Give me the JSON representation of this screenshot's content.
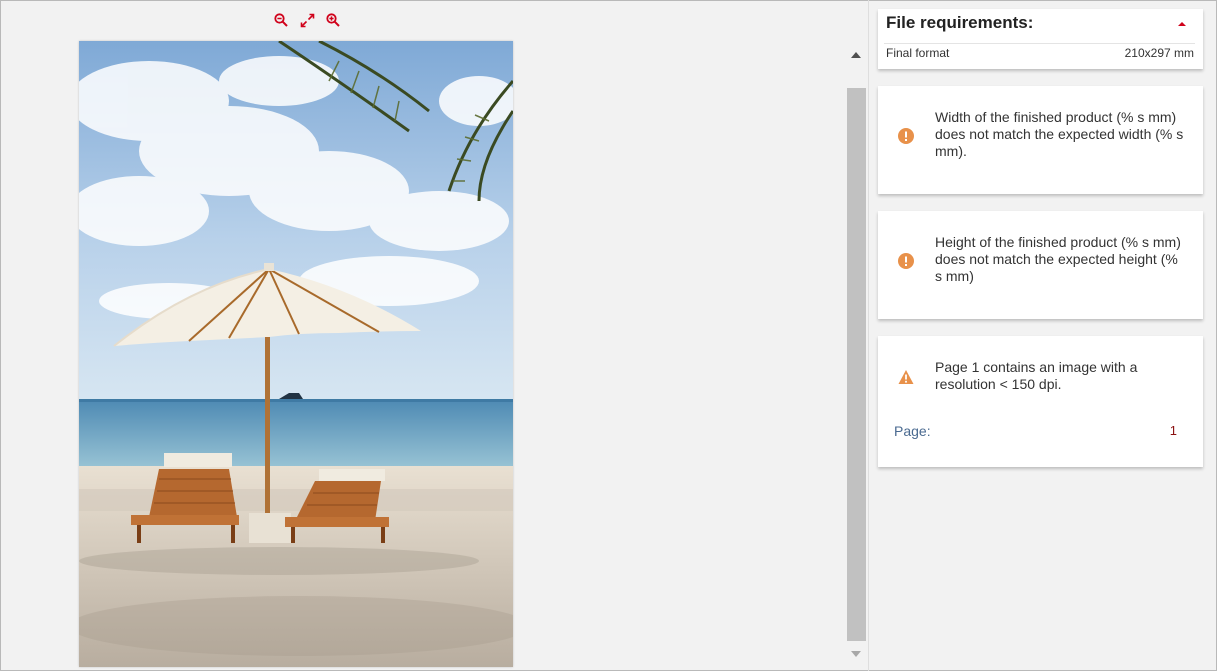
{
  "viewer": {
    "toolbar": [
      {
        "icon": "zoom-out-icon",
        "color": "#d0021b"
      },
      {
        "icon": "fullscreen-icon",
        "color": "#d0021b"
      },
      {
        "icon": "zoom-in-icon",
        "color": "#d0021b"
      }
    ],
    "preview_image": "beach umbrella and two sun loungers on sand"
  },
  "requirements": {
    "title": "File requirements:",
    "collapse_icon": "caret-up-icon",
    "final_format_label": "Final format",
    "final_format_value": "210x297 mm"
  },
  "messages": [
    {
      "icon": "error-icon",
      "color": "#e8914a",
      "text": "Width of the finished product (% s mm) does not match the expected width (% s mm)."
    },
    {
      "icon": "error-icon",
      "color": "#e8914a",
      "text": "Height of the finished product (% s mm) does not match the expected height (% s mm)"
    },
    {
      "icon": "warning-icon",
      "color": "#e8914a",
      "text": "Page 1 contains an image with a resolution < 150 dpi.",
      "page_label": "Page:",
      "page_value": "1"
    }
  ]
}
